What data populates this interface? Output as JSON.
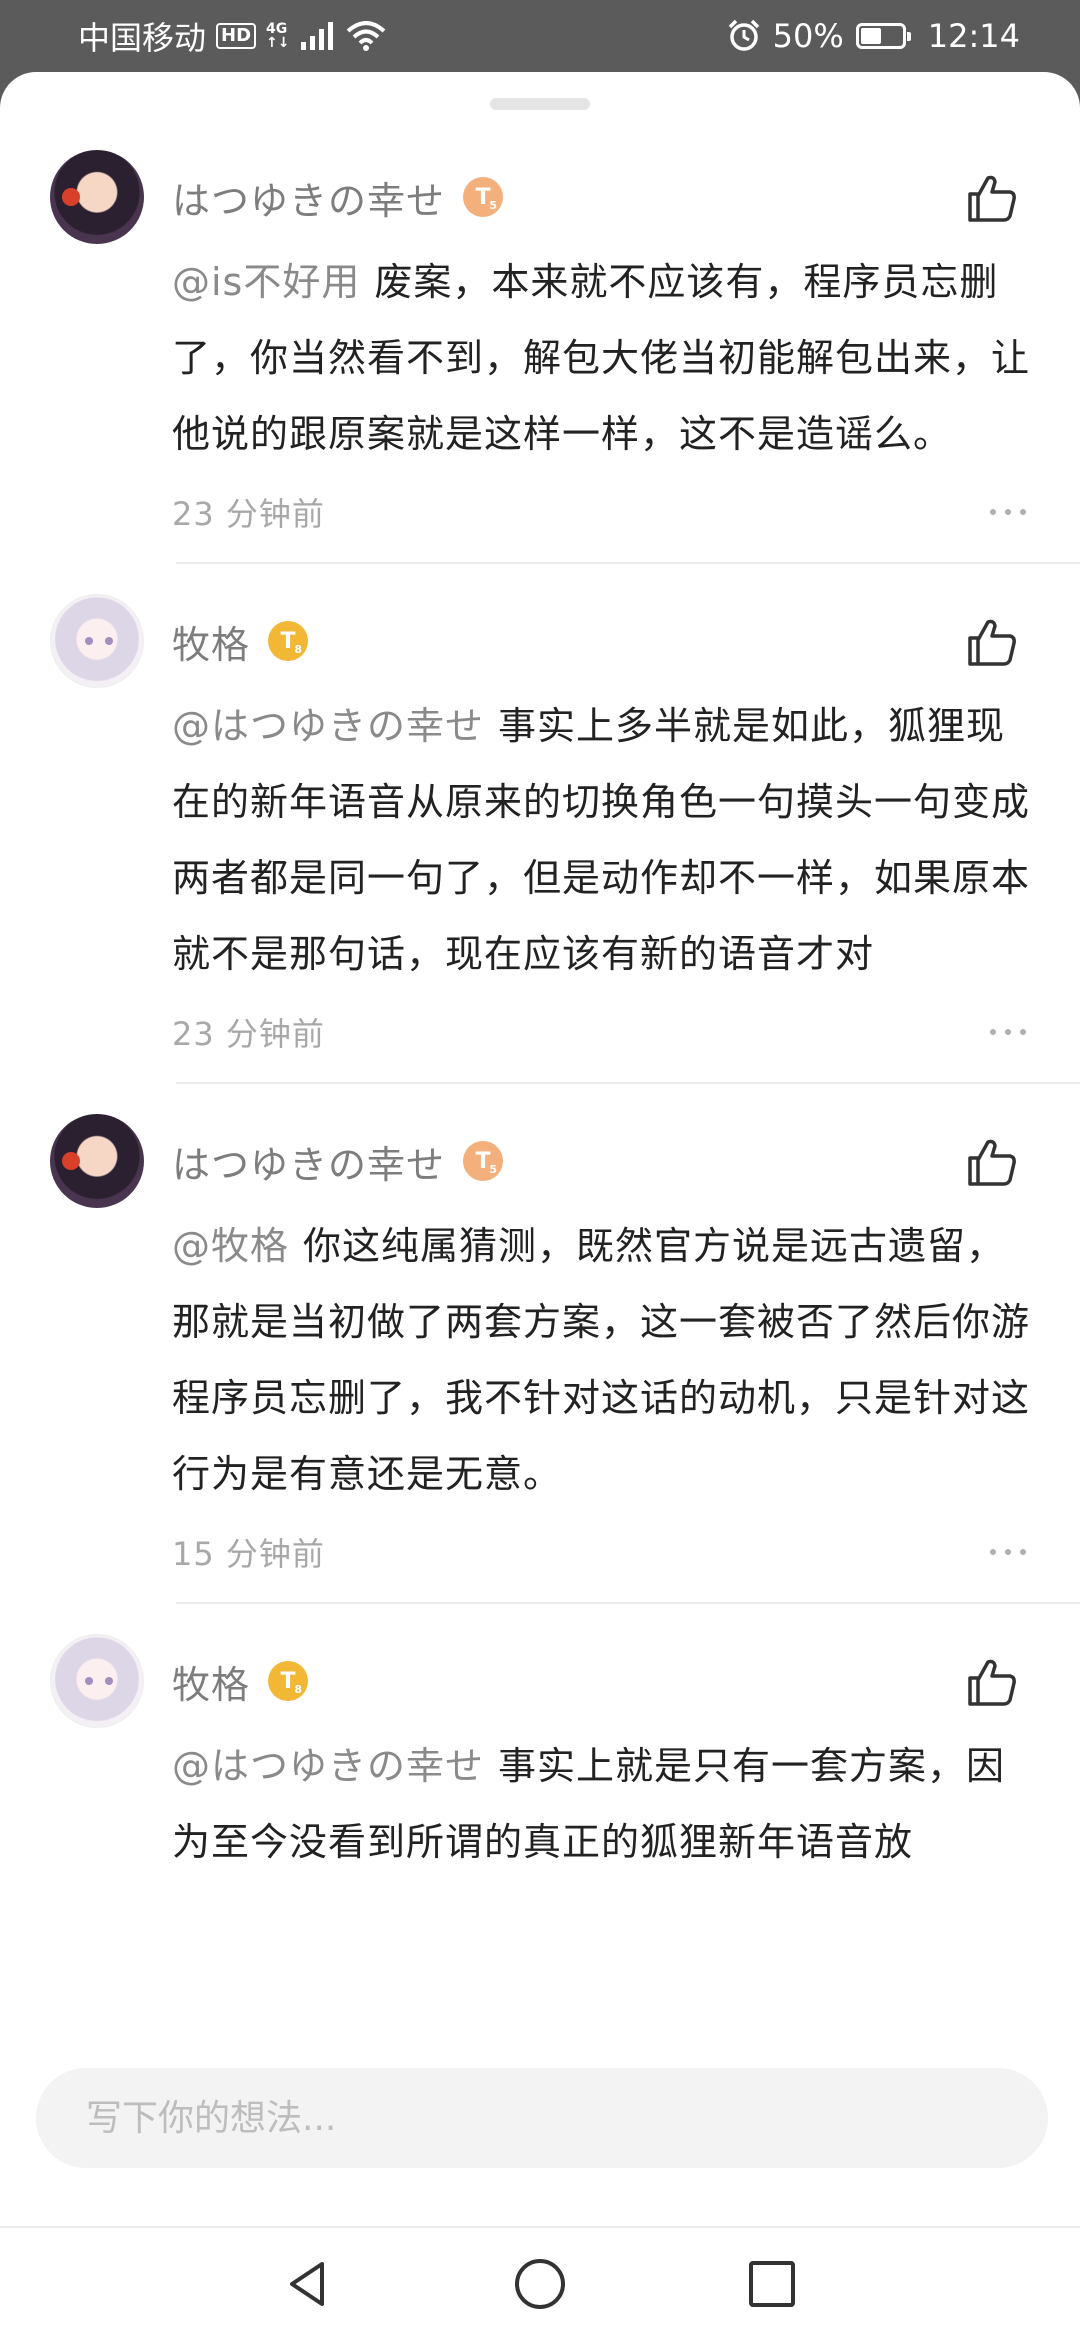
{
  "status_bar": {
    "carrier": "中国移动",
    "hd": "HD",
    "network_top": "4G",
    "network_bottom": "↑↓",
    "battery_percent": "50%",
    "battery_level": 0.5,
    "time": "12:14",
    "icons": [
      "signal-icon",
      "wifi-icon",
      "alarm-icon",
      "battery-icon"
    ]
  },
  "comments": [
    {
      "username": "はつゆきの幸せ",
      "level_letter": "T",
      "level_num": "5",
      "level_color": "#f3b07c",
      "avatar": "avatar-a",
      "mention": "@is不好用",
      "text": "废案，本来就不应该有，程序员忘删了，你当然看不到，解包大佬当初能解包出来，让他说的跟原案就是这样一样，这不是造谣么。",
      "time": "23 分钟前"
    },
    {
      "username": "牧格",
      "level_letter": "T",
      "level_num": "8",
      "level_color": "#f2b735",
      "avatar": "avatar-b",
      "mention": "@はつゆきの幸せ",
      "text": "事实上多半就是如此，狐狸现在的新年语音从原来的切换角色一句摸头一句变成两者都是同一句了，但是动作却不一样，如果原本就不是那句话，现在应该有新的语音才对",
      "time": "23 分钟前"
    },
    {
      "username": "はつゆきの幸せ",
      "level_letter": "T",
      "level_num": "5",
      "level_color": "#f3b07c",
      "avatar": "avatar-a",
      "mention": "@牧格",
      "text": "你这纯属猜测，既然官方说是远古遗留，那就是当初做了两套方案，这一套被否了然后你游程序员忘删了，我不针对这话的动机，只是针对这行为是有意还是无意。",
      "time": "15 分钟前"
    },
    {
      "username": "牧格",
      "level_letter": "T",
      "level_num": "8",
      "level_color": "#f2b735",
      "avatar": "avatar-b",
      "mention": "@はつゆきの幸せ",
      "text": "事实上就是只有一套方案，因为至今没看到所谓的真正的狐狸新年语音放",
      "time": ""
    }
  ],
  "input": {
    "placeholder": "写下你的想法..."
  },
  "nav": {
    "icons": [
      "back-icon",
      "home-icon",
      "recents-icon"
    ]
  }
}
